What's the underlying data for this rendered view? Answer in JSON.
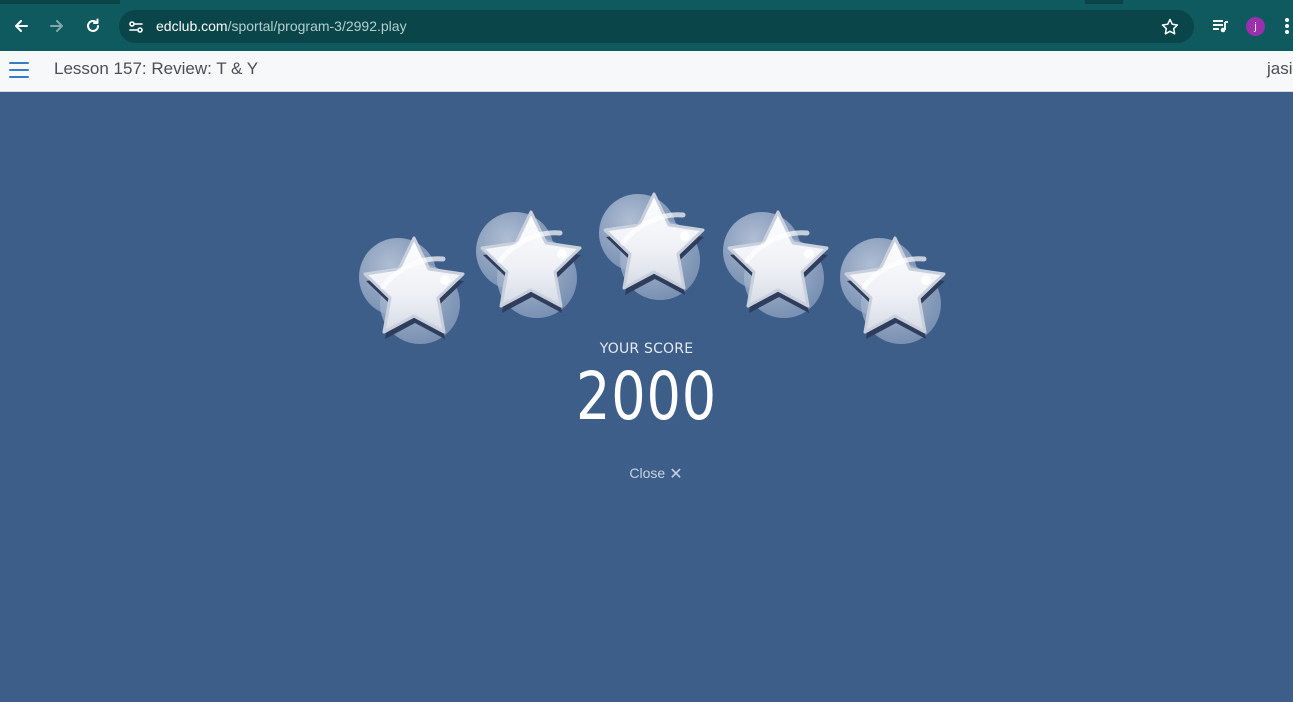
{
  "browser": {
    "url_host": "edclub.com",
    "url_path": "/sportal/program-3/2992.play",
    "profile_initial": "j"
  },
  "header": {
    "lesson_title": "Lesson 157: Review: T & Y",
    "user_name": "jasi"
  },
  "result": {
    "stars_earned": 5,
    "stars_total": 5,
    "score_label": "YOUR SCORE",
    "score_value": "2000",
    "close_label": "Close",
    "close_symbol": "✕"
  },
  "colors": {
    "chrome_bg": "#0e5a5e",
    "panel_bg": "#3d5e89",
    "header_bg": "#f7f8fa",
    "accent": "#3a7bc8"
  }
}
